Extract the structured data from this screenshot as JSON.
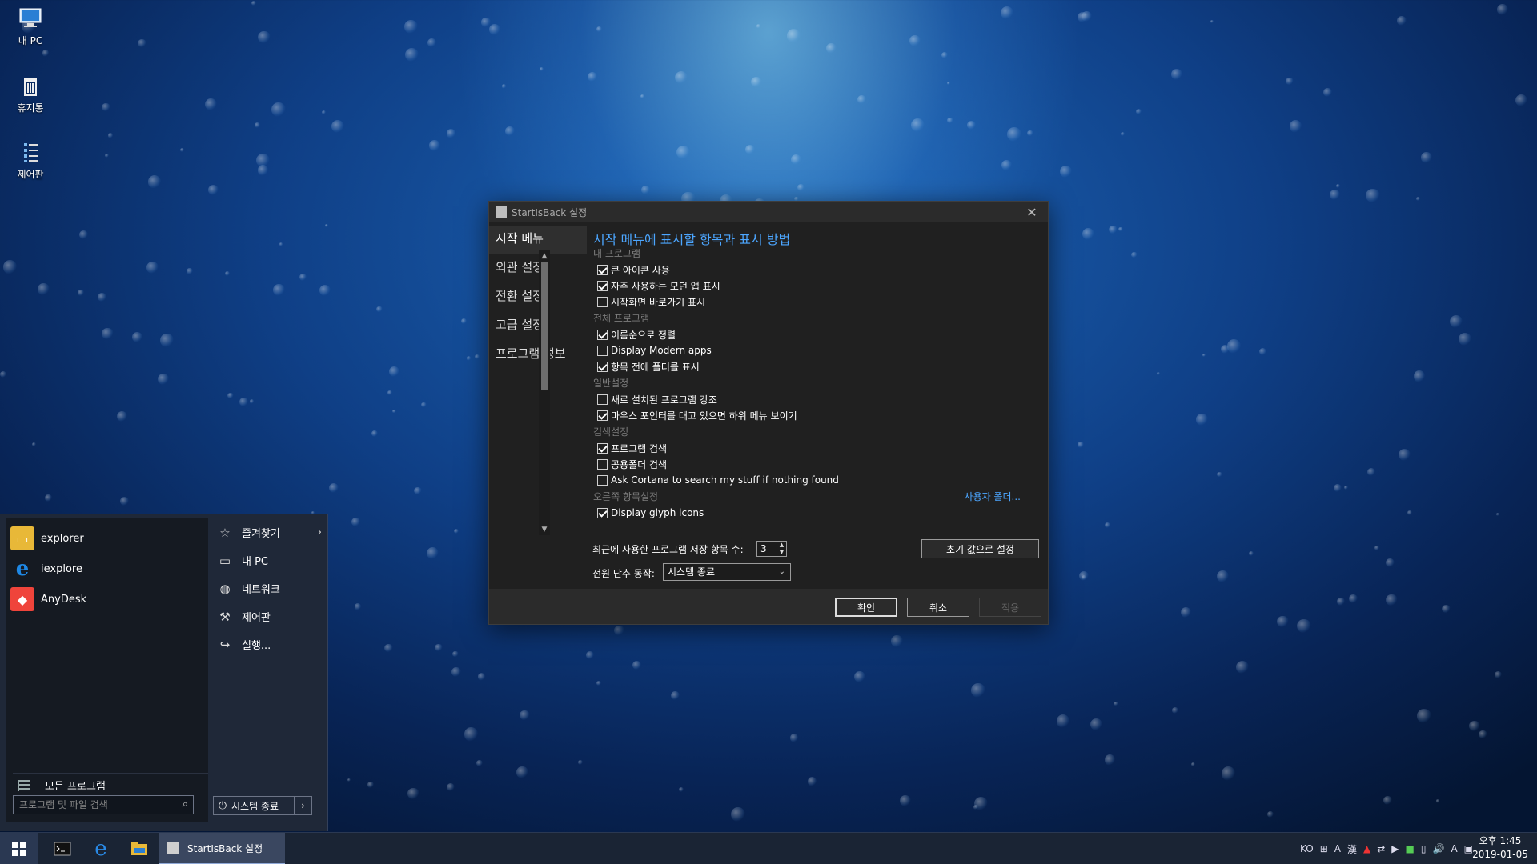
{
  "desktop": {
    "icons": [
      {
        "label": "내 PC",
        "icon": "computer-icon"
      },
      {
        "label": "휴지통",
        "icon": "recycle-bin-icon"
      },
      {
        "label": "제어판",
        "icon": "control-panel-icon"
      }
    ]
  },
  "window": {
    "title": "StartIsBack 설정",
    "nav": [
      "시작 메뉴",
      "외관 설정",
      "전환 설정",
      "고급 설정",
      "프로그램 정보"
    ],
    "heading": "시작 메뉴에 표시할 항목과 표시 방법",
    "sections": {
      "my_programs": "내 프로그램",
      "all_programs": "전체 프로그램",
      "general": "일반설정",
      "search": "검색설정",
      "right_items": "오른쪽 항목설정"
    },
    "options": {
      "large_icons": {
        "label": "큰 아이콘 사용",
        "checked": true
      },
      "frequent_modern": {
        "label": "자주 사용하는 모던 앱 표시",
        "checked": true
      },
      "start_shortcuts": {
        "label": "시작화면 바로가기 표시",
        "checked": false
      },
      "sort_by_name": {
        "label": "이름순으로 정렬",
        "checked": true
      },
      "modern_apps": {
        "label": "Display Modern apps",
        "checked": false
      },
      "folders_first": {
        "label": "항목 전에 폴더를 표시",
        "checked": true
      },
      "highlight_new": {
        "label": "새로 설치된 프로그램 강조",
        "checked": false
      },
      "hover_submenu": {
        "label": "마우스 포인터를 대고 있으면 하위 메뉴 보이기",
        "checked": true
      },
      "search_programs": {
        "label": "프로그램 검색",
        "checked": true
      },
      "search_public": {
        "label": "공용폴더 검색",
        "checked": false
      },
      "cortana": {
        "label": "Ask Cortana to search my stuff if nothing found",
        "checked": false
      },
      "glyph_icons": {
        "label": "Display glyph icons",
        "checked": true
      }
    },
    "user_folders_link": "사용자 폴더...",
    "recent_count_label": "최근에 사용한 프로그램 저장 항목 수:",
    "recent_count_value": "3",
    "power_label": "전원 단추 동작:",
    "power_value": "시스템 종료",
    "reset_button": "초기 값으로 설정",
    "ok_button": "확인",
    "cancel_button": "취소",
    "apply_button": "적용"
  },
  "start_menu": {
    "pinned": [
      {
        "label": "explorer",
        "color": "#e8b838"
      },
      {
        "label": "iexplore",
        "color": "#1e88e5"
      },
      {
        "label": "AnyDesk",
        "color": "#ef443b"
      }
    ],
    "all_programs": "모든 프로그램",
    "search_placeholder": "프로그램 및 파일 검색",
    "right_items": [
      "즐겨찾기",
      "내 PC",
      "네트워크",
      "제어판",
      "실행..."
    ],
    "shutdown": "시스템 종료"
  },
  "taskbar": {
    "task_label": "StartIsBack 설정",
    "tray": [
      "KO",
      "漢",
      "A",
      "漢",
      "A"
    ],
    "time": "오후 1:45",
    "date": "2019-01-05"
  }
}
